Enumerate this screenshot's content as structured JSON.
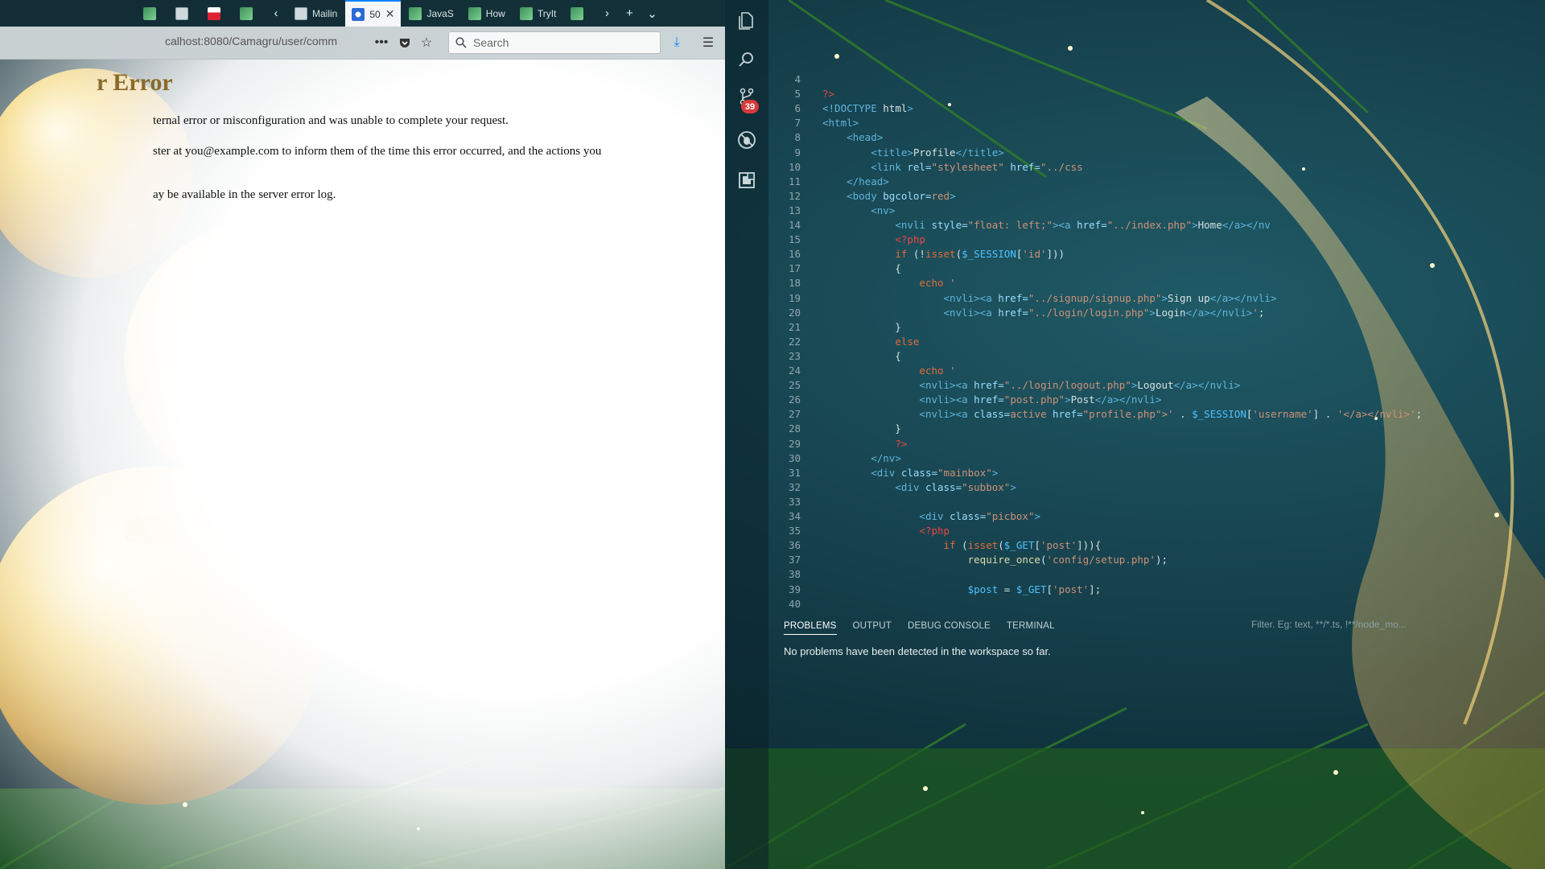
{
  "browser": {
    "tabs": [
      {
        "label": "",
        "icon": "sheet-favicon"
      },
      {
        "label": "",
        "icon": "page-favicon"
      },
      {
        "label": "",
        "icon": "red-favicon"
      },
      {
        "label": "",
        "icon": "sheet-favicon"
      },
      {
        "label": "Mailin",
        "icon": "page-favicon"
      },
      {
        "label": "50",
        "icon": "shield-favicon",
        "active": true
      },
      {
        "label": "JavaS",
        "icon": "sheet-favicon"
      },
      {
        "label": "How",
        "icon": "sheet-favicon"
      },
      {
        "label": "TryIt",
        "icon": "sheet-favicon"
      },
      {
        "label": "",
        "icon": "sheet-favicon"
      }
    ],
    "url": "calhost:8080/Camagru/user/comm",
    "search_placeholder": "Search",
    "page": {
      "title": "r Error",
      "p1": "ternal error or misconfiguration and was unable to complete your request.",
      "p2": "ster at you@example.com to inform them of the time this error occurred, and the actions you",
      "p3": "ay be available in the server error log."
    }
  },
  "vscode": {
    "problems_badge": "39",
    "lines": [
      {
        "n": "4",
        "tokens": [
          [
            "t-plain",
            ""
          ]
        ]
      },
      {
        "n": "5",
        "tokens": [
          [
            "t-php",
            "?>"
          ]
        ]
      },
      {
        "n": "6",
        "tokens": [
          [
            "t-tag",
            "<!DOCTYPE "
          ],
          [
            "t-plain",
            "html"
          ],
          [
            "t-tag",
            ">"
          ]
        ]
      },
      {
        "n": "7",
        "tokens": [
          [
            "t-tag",
            "<html>"
          ]
        ]
      },
      {
        "n": "8",
        "tokens": [
          [
            "t-plain",
            "    "
          ],
          [
            "t-tag",
            "<head>"
          ]
        ]
      },
      {
        "n": "9",
        "tokens": [
          [
            "t-plain",
            "        "
          ],
          [
            "t-tag",
            "<title>"
          ],
          [
            "t-plain",
            "Profile"
          ],
          [
            "t-tag",
            "</title>"
          ]
        ]
      },
      {
        "n": "10",
        "tokens": [
          [
            "t-plain",
            "        "
          ],
          [
            "t-tag",
            "<link "
          ],
          [
            "t-attr",
            "rel="
          ],
          [
            "t-str",
            "\"stylesheet\" "
          ],
          [
            "t-attr",
            "href="
          ],
          [
            "t-str",
            "\"../css"
          ]
        ]
      },
      {
        "n": "11",
        "tokens": [
          [
            "t-plain",
            "    "
          ],
          [
            "t-tag",
            "</head>"
          ]
        ]
      },
      {
        "n": "12",
        "tokens": [
          [
            "t-plain",
            "    "
          ],
          [
            "t-tag",
            "<body "
          ],
          [
            "t-attr",
            "bgcolor="
          ],
          [
            "t-str",
            "red"
          ],
          [
            "t-tag",
            ">"
          ]
        ]
      },
      {
        "n": "13",
        "tokens": [
          [
            "t-plain",
            "        "
          ],
          [
            "t-tag",
            "<nv>"
          ]
        ]
      },
      {
        "n": "14",
        "tokens": [
          [
            "t-plain",
            "            "
          ],
          [
            "t-tag",
            "<nvli "
          ],
          [
            "t-attr",
            "style="
          ],
          [
            "t-str",
            "\"float: left;\""
          ],
          [
            "t-tag",
            "><a "
          ],
          [
            "t-attr",
            "href="
          ],
          [
            "t-str",
            "\"../index.php\""
          ],
          [
            "t-tag",
            ">"
          ],
          [
            "t-plain",
            "Home"
          ],
          [
            "t-tag",
            "</a></nv"
          ]
        ]
      },
      {
        "n": "15",
        "tokens": [
          [
            "t-plain",
            "            "
          ],
          [
            "t-php",
            "<?php"
          ]
        ]
      },
      {
        "n": "16",
        "tokens": [
          [
            "t-plain",
            "            "
          ],
          [
            "t-kw",
            "if "
          ],
          [
            "t-plain",
            "(!"
          ],
          [
            "t-kw",
            "isset"
          ],
          [
            "t-plain",
            "("
          ],
          [
            "t-var",
            "$_SESSION"
          ],
          [
            "t-plain",
            "["
          ],
          [
            "t-str",
            "'id'"
          ],
          [
            "t-plain",
            "]))"
          ]
        ]
      },
      {
        "n": "17",
        "tokens": [
          [
            "t-plain",
            "            {"
          ]
        ]
      },
      {
        "n": "18",
        "tokens": [
          [
            "t-plain",
            "                "
          ],
          [
            "t-kw",
            "echo "
          ],
          [
            "t-str",
            "'"
          ]
        ]
      },
      {
        "n": "19",
        "tokens": [
          [
            "t-plain",
            "                    "
          ],
          [
            "t-tag",
            "<nvli><a "
          ],
          [
            "t-attr",
            "href="
          ],
          [
            "t-str",
            "\"../signup/signup.php\""
          ],
          [
            "t-tag",
            ">"
          ],
          [
            "t-plain",
            "Sign up"
          ],
          [
            "t-tag",
            "</a></nvli>"
          ]
        ]
      },
      {
        "n": "20",
        "tokens": [
          [
            "t-plain",
            "                    "
          ],
          [
            "t-tag",
            "<nvli><a "
          ],
          [
            "t-attr",
            "href="
          ],
          [
            "t-str",
            "\"../login/login.php\""
          ],
          [
            "t-tag",
            ">"
          ],
          [
            "t-plain",
            "Login"
          ],
          [
            "t-tag",
            "</a></nvli>"
          ],
          [
            "t-str",
            "'"
          ],
          [
            "t-plain",
            ";"
          ]
        ]
      },
      {
        "n": "21",
        "tokens": [
          [
            "t-plain",
            "            }"
          ]
        ]
      },
      {
        "n": "22",
        "tokens": [
          [
            "t-plain",
            "            "
          ],
          [
            "t-kw",
            "else"
          ]
        ]
      },
      {
        "n": "23",
        "tokens": [
          [
            "t-plain",
            "            {"
          ]
        ]
      },
      {
        "n": "24",
        "tokens": [
          [
            "t-plain",
            "                "
          ],
          [
            "t-kw",
            "echo "
          ],
          [
            "t-str",
            "'"
          ]
        ]
      },
      {
        "n": "25",
        "tokens": [
          [
            "t-plain",
            "                "
          ],
          [
            "t-tag",
            "<nvli><a "
          ],
          [
            "t-attr",
            "href="
          ],
          [
            "t-str",
            "\"../login/logout.php\""
          ],
          [
            "t-tag",
            ">"
          ],
          [
            "t-plain",
            "Logout"
          ],
          [
            "t-tag",
            "</a></nvli>"
          ]
        ]
      },
      {
        "n": "26",
        "tokens": [
          [
            "t-plain",
            "                "
          ],
          [
            "t-tag",
            "<nvli><a "
          ],
          [
            "t-attr",
            "href="
          ],
          [
            "t-str",
            "\"post.php\""
          ],
          [
            "t-tag",
            ">"
          ],
          [
            "t-plain",
            "Post"
          ],
          [
            "t-tag",
            "</a></nvli>"
          ]
        ]
      },
      {
        "n": "27",
        "tokens": [
          [
            "t-plain",
            "                "
          ],
          [
            "t-tag",
            "<nvli><a "
          ],
          [
            "t-attr",
            "class="
          ],
          [
            "t-str",
            "active "
          ],
          [
            "t-attr",
            "href="
          ],
          [
            "t-str",
            "\"profile.php\">' "
          ],
          [
            "t-plain",
            ". "
          ],
          [
            "t-var",
            "$_SESSION"
          ],
          [
            "t-plain",
            "["
          ],
          [
            "t-str",
            "'username'"
          ],
          [
            "t-plain",
            "] . "
          ],
          [
            "t-str",
            "'</a></nvli>'"
          ],
          [
            "t-plain",
            ";"
          ]
        ]
      },
      {
        "n": "28",
        "tokens": [
          [
            "t-plain",
            "            }"
          ]
        ]
      },
      {
        "n": "29",
        "tokens": [
          [
            "t-plain",
            "            "
          ],
          [
            "t-php",
            "?>"
          ]
        ]
      },
      {
        "n": "30",
        "tokens": [
          [
            "t-plain",
            "        "
          ],
          [
            "t-tag",
            "</nv>"
          ]
        ]
      },
      {
        "n": "31",
        "tokens": [
          [
            "t-plain",
            "        "
          ],
          [
            "t-tag",
            "<div "
          ],
          [
            "t-attr",
            "class="
          ],
          [
            "t-str",
            "\"mainbox\""
          ],
          [
            "t-tag",
            ">"
          ]
        ]
      },
      {
        "n": "32",
        "tokens": [
          [
            "t-plain",
            "            "
          ],
          [
            "t-tag",
            "<div "
          ],
          [
            "t-attr",
            "class="
          ],
          [
            "t-str",
            "\"subbox\""
          ],
          [
            "t-tag",
            ">"
          ]
        ]
      },
      {
        "n": "33",
        "tokens": [
          [
            "t-plain",
            ""
          ]
        ]
      },
      {
        "n": "34",
        "tokens": [
          [
            "t-plain",
            "                "
          ],
          [
            "t-tag",
            "<div "
          ],
          [
            "t-attr",
            "class="
          ],
          [
            "t-str",
            "\"picbox\""
          ],
          [
            "t-tag",
            ">"
          ]
        ]
      },
      {
        "n": "35",
        "tokens": [
          [
            "t-plain",
            "                "
          ],
          [
            "t-php",
            "<?php"
          ]
        ]
      },
      {
        "n": "36",
        "tokens": [
          [
            "t-plain",
            "                    "
          ],
          [
            "t-kw",
            "if "
          ],
          [
            "t-plain",
            "("
          ],
          [
            "t-kw",
            "isset"
          ],
          [
            "t-plain",
            "("
          ],
          [
            "t-var",
            "$_GET"
          ],
          [
            "t-plain",
            "["
          ],
          [
            "t-str",
            "'post'"
          ],
          [
            "t-plain",
            "])){"
          ]
        ]
      },
      {
        "n": "37",
        "tokens": [
          [
            "t-plain",
            "                        "
          ],
          [
            "t-fn",
            "require_once"
          ],
          [
            "t-plain",
            "("
          ],
          [
            "t-str",
            "'config/setup.php'"
          ],
          [
            "t-plain",
            ");"
          ]
        ]
      },
      {
        "n": "38",
        "tokens": [
          [
            "t-plain",
            ""
          ]
        ]
      },
      {
        "n": "39",
        "tokens": [
          [
            "t-plain",
            "                        "
          ],
          [
            "t-var",
            "$post"
          ],
          [
            "t-plain",
            " = "
          ],
          [
            "t-var",
            "$_GET"
          ],
          [
            "t-plain",
            "["
          ],
          [
            "t-str",
            "'post'"
          ],
          [
            "t-plain",
            "];"
          ]
        ]
      },
      {
        "n": "40",
        "tokens": [
          [
            "t-plain",
            ""
          ]
        ]
      }
    ],
    "panel": {
      "tabs": [
        "PROBLEMS",
        "OUTPUT",
        "DEBUG CONSOLE",
        "TERMINAL"
      ],
      "filter_placeholder": "Filter. Eg: text, **/*.ts, !**/node_mo...",
      "message": "No problems have been detected in the workspace so far."
    }
  }
}
